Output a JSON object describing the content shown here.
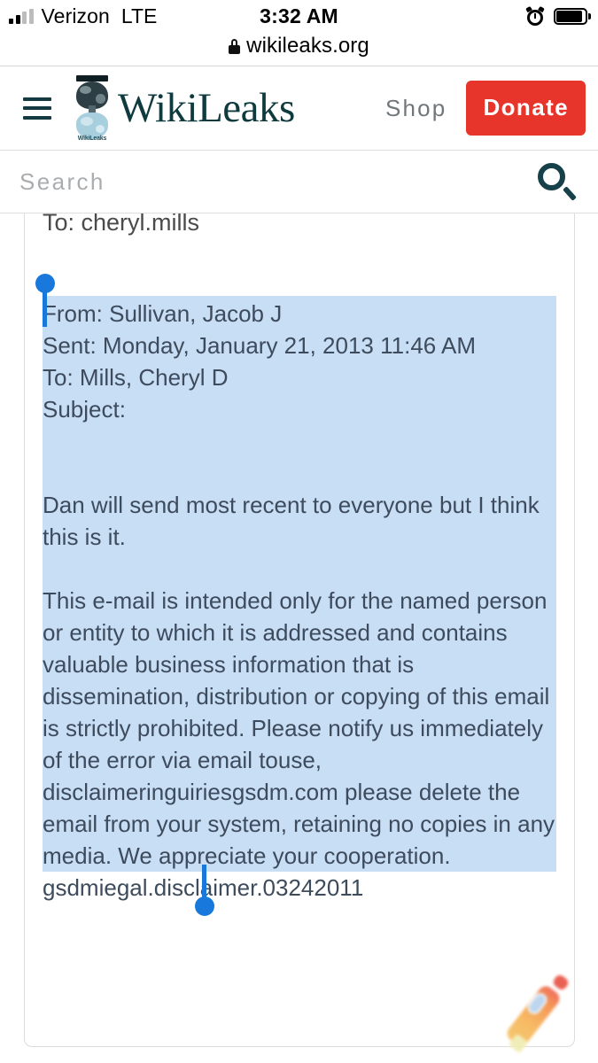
{
  "status_bar": {
    "carrier": "Verizon",
    "network": "LTE",
    "time": "3:32 AM",
    "alarm_icon": "alarm-clock-icon",
    "battery_icon": "battery-full-icon",
    "signal_icon": "signal-bars-icon"
  },
  "browser": {
    "lock_icon": "lock-icon",
    "url": "wikileaks.org"
  },
  "site_header": {
    "menu_icon": "hamburger-menu-icon",
    "logo_icon": "wikileaks-hourglass-logo",
    "logo_word": "WikiLeaks",
    "brand": "WikiLeaks",
    "shop_label": "Shop",
    "donate_label": "Donate",
    "donate_color": "#e8352b",
    "brand_color": "#0f3b3f"
  },
  "search": {
    "placeholder": "Search",
    "value": "",
    "icon": "search-magnifier-icon",
    "icon_color": "#16414a"
  },
  "document": {
    "clipped_line": "To: cheryl.mills",
    "selection_color": "#c8def5",
    "handle_color": "#1878dc",
    "selected_text": {
      "from": "From: Sullivan, Jacob J",
      "sent": "Sent: Monday, January 21, 2013 11:46 AM",
      "to": "To: Mills, Cheryl D",
      "subject": "Subject:",
      "body_paragraph_1": "Dan will send most recent to everyone but I think this is it.",
      "body_paragraph_2": "This e-mail is intended only for the named person or entity to which it is addressed and contains valuable business information that is dissemination, distribution or copying of this email is strictly prohibited. Please notify us immediately of the error via email touse, disclaimeringuiriesgsdm.com please delete the email from your system, retaining no copies in any media. We appreciate your cooperation."
    },
    "unselected_tail": "gsdmiegal.disclaimer.03242011"
  },
  "overlay": {
    "pen_icon": "pen-marker-icon"
  }
}
